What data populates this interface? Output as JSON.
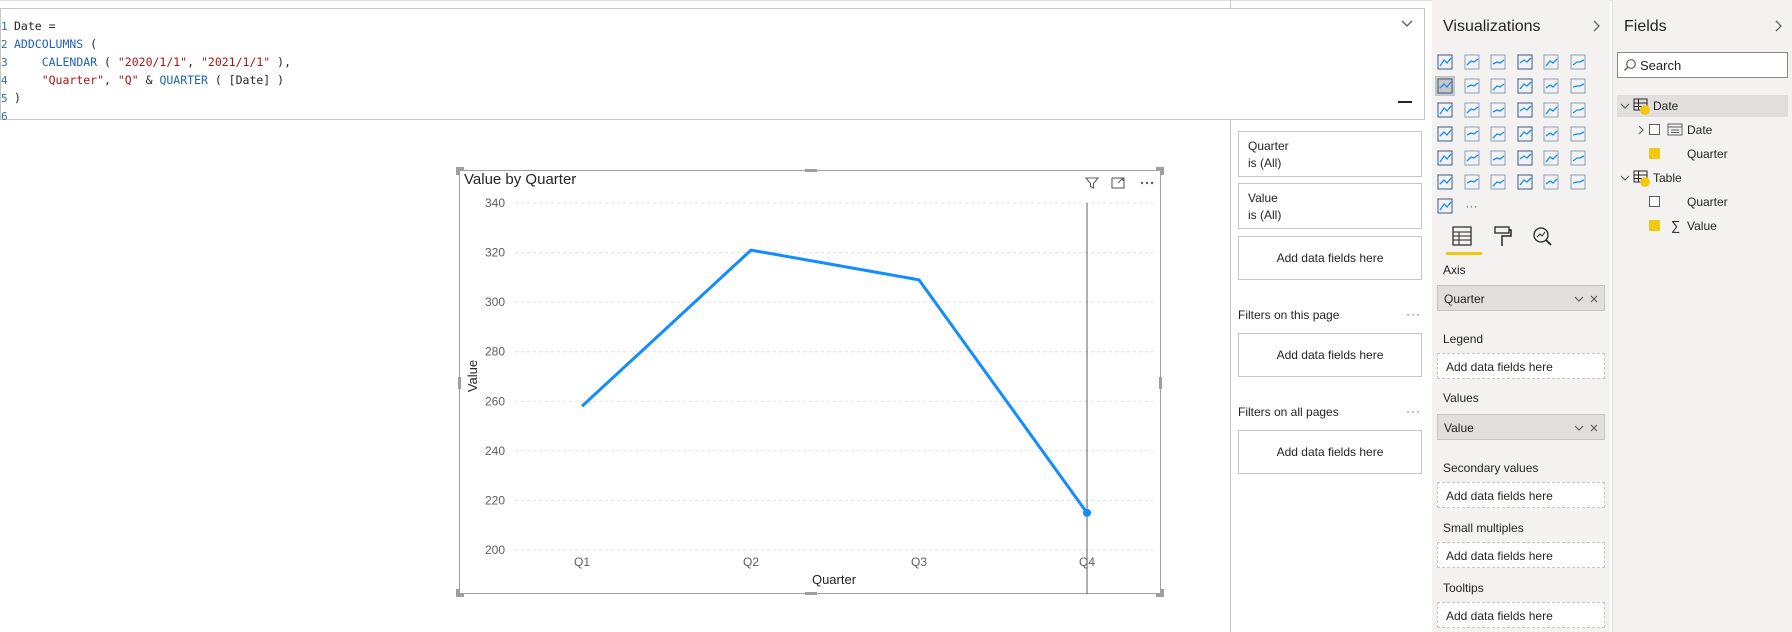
{
  "formula_bar": {
    "lines": [
      {
        "num": "1",
        "segments": [
          {
            "text": "Date =",
            "cls": "plain"
          }
        ]
      },
      {
        "num": "2",
        "segments": [
          {
            "text": "ADDCOLUMNS",
            "cls": "kw"
          },
          {
            "text": " (",
            "cls": "plain"
          }
        ]
      },
      {
        "num": "3",
        "segments": [
          {
            "text": "    ",
            "cls": "plain"
          },
          {
            "text": "CALENDAR",
            "cls": "kw"
          },
          {
            "text": " ( ",
            "cls": "plain"
          },
          {
            "text": "\"2020/1/1\"",
            "cls": "str"
          },
          {
            "text": ", ",
            "cls": "plain"
          },
          {
            "text": "\"2021/1/1\"",
            "cls": "str"
          },
          {
            "text": " ),",
            "cls": "plain"
          }
        ]
      },
      {
        "num": "4",
        "segments": [
          {
            "text": "    ",
            "cls": "plain"
          },
          {
            "text": "\"Quarter\"",
            "cls": "str"
          },
          {
            "text": ", ",
            "cls": "plain"
          },
          {
            "text": "\"Q\"",
            "cls": "str"
          },
          {
            "text": " & ",
            "cls": "plain"
          },
          {
            "text": "QUARTER",
            "cls": "kw"
          },
          {
            "text": " ( [Date] )",
            "cls": "plain"
          }
        ]
      },
      {
        "num": "5",
        "segments": [
          {
            "text": ")",
            "cls": "plain"
          }
        ]
      },
      {
        "num": "6",
        "segments": []
      }
    ]
  },
  "chart": {
    "title": "Value by Quarter",
    "xlabel": "Quarter",
    "ylabel": "Value",
    "icons": [
      "filter-icon",
      "focus-mode-icon",
      "more-options-icon"
    ]
  },
  "chart_data": {
    "type": "line",
    "title": "Value by Quarter",
    "xlabel": "Quarter",
    "ylabel": "Value",
    "categories": [
      "Q1",
      "Q2",
      "Q3",
      "Q4"
    ],
    "series": [
      {
        "values": [
          258,
          321,
          309,
          215
        ]
      }
    ],
    "ylim": [
      200,
      340
    ],
    "yticks": [
      200,
      220,
      240,
      260,
      280,
      300,
      320,
      340
    ],
    "grid": true,
    "line_color": "#118DFF",
    "hover_category": "Q4"
  },
  "filters": {
    "cards": [
      {
        "title": "Quarter",
        "state": "is (All)"
      },
      {
        "title": "Value",
        "state": "is (All)"
      }
    ],
    "visual_drop": "Add data fields here",
    "page_header": "Filters on this page",
    "page_drop": "Add data fields here",
    "all_header": "Filters on all pages",
    "all_drop": "Add data fields here",
    "dots": "···"
  },
  "visualizations": {
    "title": "Visualizations",
    "more": "···",
    "icon_names": [
      "stacked-bar-chart-icon",
      "stacked-column-chart-icon",
      "clustered-bar-chart-icon",
      "clustered-column-chart-icon",
      "100-bar-chart-icon",
      "100-column-chart-icon",
      "line-chart-icon",
      "area-chart-icon",
      "stacked-area-chart-icon",
      "line-column-chart-icon",
      "line-clustered-column-icon",
      "ribbon-chart-icon",
      "waterfall-chart-icon",
      "funnel-chart-icon",
      "scatter-chart-icon",
      "pie-chart-icon",
      "donut-chart-icon",
      "treemap-icon",
      "map-icon",
      "filled-map-icon",
      "gauge-icon",
      "card-icon",
      "multi-row-card-icon",
      "kpi-icon",
      "slicer-icon",
      "table-icon",
      "matrix-icon",
      "r-script-icon",
      "python-icon",
      "key-influencers-icon",
      "decomposition-tree-icon",
      "qa-icon",
      "smart-narrative-icon",
      "paginated-report-icon",
      "power-apps-icon",
      "power-automate-icon",
      "arcgis-icon",
      "more-visuals-icon"
    ],
    "wells": {
      "axis_label": "Axis",
      "axis_value": "Quarter",
      "legend_label": "Legend",
      "legend_placeholder": "Add data fields here",
      "values_label": "Values",
      "values_value": "Value",
      "secondary_label": "Secondary values",
      "secondary_placeholder": "Add data fields here",
      "small_multiples_label": "Small multiples",
      "small_multiples_placeholder": "Add data fields here",
      "tooltips_label": "Tooltips",
      "tooltips_placeholder": "Add data fields here"
    }
  },
  "fields": {
    "title": "Fields",
    "search_placeholder": "Search",
    "tables": [
      {
        "name": "Date",
        "items": [
          {
            "name": "Date",
            "checked": false,
            "kind": "hierarchy"
          },
          {
            "name": "Quarter",
            "checked": true,
            "kind": "text"
          }
        ]
      },
      {
        "name": "Table",
        "items": [
          {
            "name": "Quarter",
            "checked": false,
            "kind": "text"
          },
          {
            "name": "Value",
            "checked": true,
            "kind": "sum"
          }
        ]
      }
    ],
    "sum_glyph": "∑"
  },
  "colors": {
    "accent_yellow": "#F2C811",
    "line_blue": "#118DFF"
  }
}
